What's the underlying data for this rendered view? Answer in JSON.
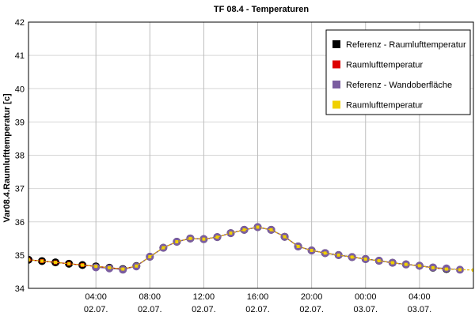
{
  "chart_data": {
    "type": "line",
    "title": "TF 08.4 - Temperaturen",
    "ylabel": "Var08.4.Raumlufttemperatur [c]",
    "xlabel": "",
    "xlim": [
      "2019-07-01T23:00",
      "2019-07-03T08:00"
    ],
    "ylim": [
      34,
      42
    ],
    "yticks": [
      34,
      35,
      36,
      37,
      38,
      39,
      40,
      41,
      42
    ],
    "xticks": [
      {
        "time": "2019-07-02T04:00",
        "hour": "04:00",
        "date": "02.07."
      },
      {
        "time": "2019-07-02T08:00",
        "hour": "08:00",
        "date": "02.07."
      },
      {
        "time": "2019-07-02T12:00",
        "hour": "12:00",
        "date": "02.07."
      },
      {
        "time": "2019-07-02T16:00",
        "hour": "16:00",
        "date": "02.07."
      },
      {
        "time": "2019-07-02T20:00",
        "hour": "20:00",
        "date": "02.07."
      },
      {
        "time": "2019-07-03T00:00",
        "hour": "00:00",
        "date": "03.07."
      },
      {
        "time": "2019-07-03T04:00",
        "hour": "04:00",
        "date": "03.07."
      }
    ],
    "grid": true,
    "legend_position": "top-right",
    "series": [
      {
        "name": "Referenz - Raumlufttemperatur",
        "color": "#000000",
        "marker": "circle",
        "x": [
          "2019-07-01T23:00",
          "2019-07-02T00:00",
          "2019-07-02T01:00",
          "2019-07-02T02:00",
          "2019-07-02T03:00",
          "2019-07-02T04:00",
          "2019-07-02T05:00",
          "2019-07-02T06:00",
          "2019-07-02T07:00",
          "2019-07-02T08:00",
          "2019-07-02T09:00",
          "2019-07-02T10:00",
          "2019-07-02T11:00",
          "2019-07-02T12:00",
          "2019-07-02T13:00",
          "2019-07-02T14:00",
          "2019-07-02T15:00",
          "2019-07-02T16:00",
          "2019-07-02T17:00",
          "2019-07-02T18:00",
          "2019-07-02T19:00",
          "2019-07-02T20:00",
          "2019-07-02T21:00",
          "2019-07-02T22:00",
          "2019-07-02T23:00",
          "2019-07-03T00:00",
          "2019-07-03T01:00",
          "2019-07-03T02:00",
          "2019-07-03T03:00",
          "2019-07-03T04:00",
          "2019-07-03T05:00",
          "2019-07-03T06:00"
        ],
        "y": [
          34.86,
          34.82,
          34.78,
          34.74,
          34.7,
          34.66,
          34.62,
          34.58,
          34.67,
          34.95,
          35.22,
          35.4,
          35.5,
          35.48,
          35.54,
          35.66,
          35.76,
          35.84,
          35.76,
          35.55,
          35.26,
          35.14,
          35.06,
          35.0,
          34.94,
          34.88,
          34.83,
          34.77,
          34.72,
          34.68,
          34.62,
          34.58
        ]
      },
      {
        "name": "Raumlufttemperatur",
        "color": "#dd0000",
        "marker": "square",
        "x": [
          "2019-07-01T23:00",
          "2019-07-02T00:00",
          "2019-07-02T01:00",
          "2019-07-02T02:00",
          "2019-07-02T03:00",
          "2019-07-02T04:00",
          "2019-07-02T05:00",
          "2019-07-02T06:00",
          "2019-07-02T07:00",
          "2019-07-02T08:00",
          "2019-07-02T09:00",
          "2019-07-02T10:00",
          "2019-07-02T11:00",
          "2019-07-02T12:00",
          "2019-07-02T13:00",
          "2019-07-02T14:00",
          "2019-07-02T15:00",
          "2019-07-02T16:00",
          "2019-07-02T17:00",
          "2019-07-02T18:00",
          "2019-07-02T19:00",
          "2019-07-02T20:00",
          "2019-07-02T21:00",
          "2019-07-02T22:00",
          "2019-07-02T23:00",
          "2019-07-03T00:00",
          "2019-07-03T01:00",
          "2019-07-03T02:00",
          "2019-07-03T03:00",
          "2019-07-03T04:00",
          "2019-07-03T05:00",
          "2019-07-03T06:00"
        ],
        "y": [
          34.86,
          34.82,
          34.78,
          34.74,
          34.7,
          34.66,
          34.62,
          34.58,
          34.67,
          34.95,
          35.22,
          35.4,
          35.5,
          35.48,
          35.54,
          35.66,
          35.76,
          35.84,
          35.76,
          35.55,
          35.26,
          35.14,
          35.06,
          35.0,
          34.94,
          34.88,
          34.83,
          34.77,
          34.72,
          34.68,
          34.62,
          34.58
        ]
      },
      {
        "name": "Referenz - Wandoberfläche",
        "color": "#7b5da0",
        "marker": "circle",
        "x": [
          "2019-07-02T04:00",
          "2019-07-02T05:00",
          "2019-07-02T06:00",
          "2019-07-02T07:00",
          "2019-07-02T08:00",
          "2019-07-02T09:00",
          "2019-07-02T10:00",
          "2019-07-02T11:00",
          "2019-07-02T12:00",
          "2019-07-02T13:00",
          "2019-07-02T14:00",
          "2019-07-02T15:00",
          "2019-07-02T16:00",
          "2019-07-02T17:00",
          "2019-07-02T18:00",
          "2019-07-02T19:00",
          "2019-07-02T20:00",
          "2019-07-02T21:00",
          "2019-07-02T22:00",
          "2019-07-02T23:00",
          "2019-07-03T00:00",
          "2019-07-03T01:00",
          "2019-07-03T02:00",
          "2019-07-03T03:00",
          "2019-07-03T04:00",
          "2019-07-03T05:00",
          "2019-07-03T06:00",
          "2019-07-03T07:00"
        ],
        "y": [
          34.63,
          34.6,
          34.56,
          34.66,
          34.95,
          35.22,
          35.4,
          35.5,
          35.48,
          35.54,
          35.66,
          35.76,
          35.84,
          35.76,
          35.55,
          35.26,
          35.14,
          35.06,
          35.0,
          34.94,
          34.88,
          34.83,
          34.77,
          34.72,
          34.68,
          34.63,
          34.6,
          34.56
        ]
      },
      {
        "name": "Raumlufttemperatur",
        "color": "#f0d000",
        "marker": "square",
        "x": [
          "2019-07-01T23:00",
          "2019-07-02T00:00",
          "2019-07-02T01:00",
          "2019-07-02T02:00",
          "2019-07-02T03:00",
          "2019-07-02T04:00",
          "2019-07-02T05:00",
          "2019-07-02T06:00",
          "2019-07-02T07:00",
          "2019-07-02T08:00",
          "2019-07-02T09:00",
          "2019-07-02T10:00",
          "2019-07-02T11:00",
          "2019-07-02T12:00",
          "2019-07-02T13:00",
          "2019-07-02T14:00",
          "2019-07-02T15:00",
          "2019-07-02T16:00",
          "2019-07-02T17:00",
          "2019-07-02T18:00",
          "2019-07-02T19:00",
          "2019-07-02T20:00",
          "2019-07-02T21:00",
          "2019-07-02T22:00",
          "2019-07-02T23:00",
          "2019-07-03T00:00",
          "2019-07-03T01:00",
          "2019-07-03T02:00",
          "2019-07-03T03:00",
          "2019-07-03T04:00",
          "2019-07-03T05:00",
          "2019-07-03T06:00",
          "2019-07-03T07:00",
          "2019-07-03T08:00"
        ],
        "y": [
          34.86,
          34.82,
          34.78,
          34.74,
          34.7,
          34.66,
          34.62,
          34.58,
          34.67,
          34.95,
          35.22,
          35.4,
          35.5,
          35.48,
          35.54,
          35.66,
          35.76,
          35.84,
          35.76,
          35.55,
          35.26,
          35.14,
          35.06,
          35.0,
          34.94,
          34.88,
          34.83,
          34.77,
          34.72,
          34.68,
          34.62,
          34.58,
          34.56,
          34.55
        ]
      }
    ]
  }
}
